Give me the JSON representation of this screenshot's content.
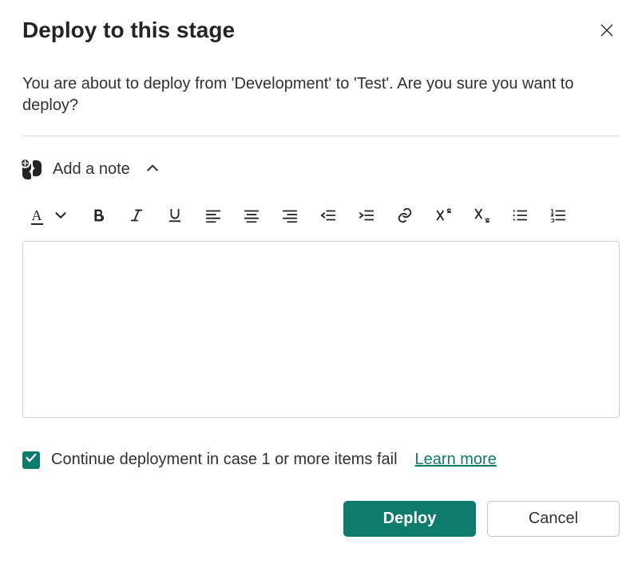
{
  "dialog": {
    "title": "Deploy to this stage",
    "description": "You are about to deploy from 'Development' to 'Test'. Are you sure you want to deploy?",
    "close_label": "Close"
  },
  "note_section": {
    "label": "Add a note",
    "expanded": true,
    "textarea_value": "",
    "textarea_placeholder": ""
  },
  "toolbar": {
    "font_color": {
      "label": "A",
      "tooltip": "Font color"
    },
    "bold": {
      "tooltip": "Bold"
    },
    "italic": {
      "tooltip": "Italic"
    },
    "underline": {
      "tooltip": "Underline"
    },
    "align_left": {
      "tooltip": "Align left"
    },
    "align_center": {
      "tooltip": "Align center"
    },
    "align_right": {
      "tooltip": "Align right"
    },
    "outdent": {
      "tooltip": "Decrease indent"
    },
    "indent": {
      "tooltip": "Increase indent"
    },
    "link": {
      "tooltip": "Insert link"
    },
    "superscript": {
      "tooltip": "Superscript"
    },
    "subscript": {
      "tooltip": "Subscript"
    },
    "bulleted_list": {
      "tooltip": "Bulleted list"
    },
    "numbered_list": {
      "tooltip": "Numbered list"
    }
  },
  "checkbox": {
    "checked": true,
    "label": "Continue deployment in case 1 or more items fail",
    "learn_more": "Learn more"
  },
  "footer": {
    "primary": "Deploy",
    "secondary": "Cancel"
  },
  "colors": {
    "accent": "#0f7b6c"
  }
}
